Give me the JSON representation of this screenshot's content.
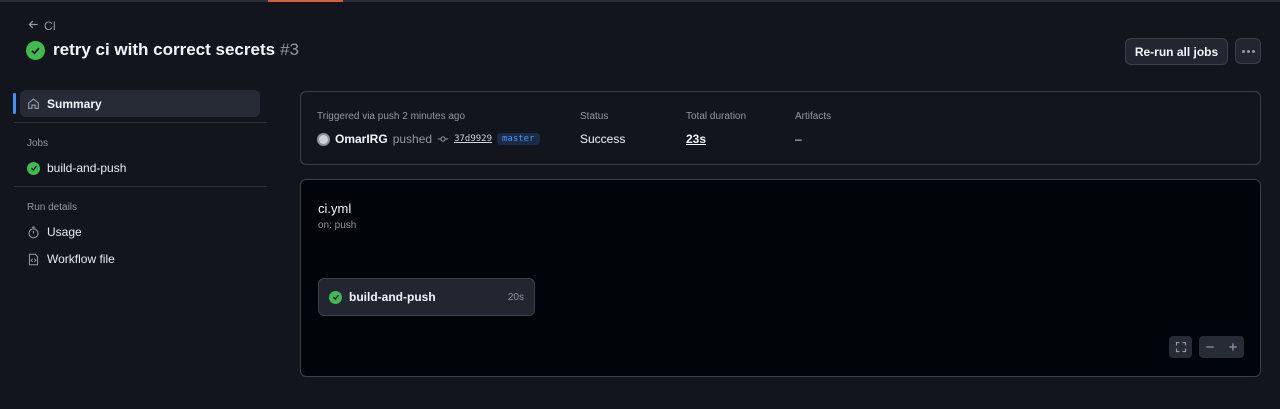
{
  "header": {
    "back_label": "CI",
    "run_title": "retry ci with correct secrets",
    "run_number": "#3",
    "rerun_label": "Re-run all jobs",
    "more_icon": "kebab-horizontal-icon"
  },
  "sidebar": {
    "summary_label": "Summary",
    "jobs_heading": "Jobs",
    "jobs": [
      {
        "label": "build-and-push",
        "status": "success"
      }
    ],
    "run_details_heading": "Run details",
    "run_details": [
      {
        "label": "Usage",
        "icon": "stopwatch-icon"
      },
      {
        "label": "Workflow file",
        "icon": "file-code-icon"
      }
    ]
  },
  "summary": {
    "trigger_label": "Triggered via push 2 minutes ago",
    "actor": "OmarIRG",
    "action": "pushed",
    "commit_sha": "37d9929",
    "branch": "master",
    "status_label": "Status",
    "status_value": "Success",
    "duration_label": "Total duration",
    "duration_value": "23s",
    "artifacts_label": "Artifacts",
    "artifacts_value": "–"
  },
  "workflow": {
    "file_name": "ci.yml",
    "trigger": "on: push",
    "jobs": [
      {
        "name": "build-and-push",
        "duration": "20s",
        "status": "success"
      }
    ]
  },
  "colors": {
    "success": "#3fb950",
    "accent_blue": "#4493f8",
    "background": "#13151d"
  }
}
